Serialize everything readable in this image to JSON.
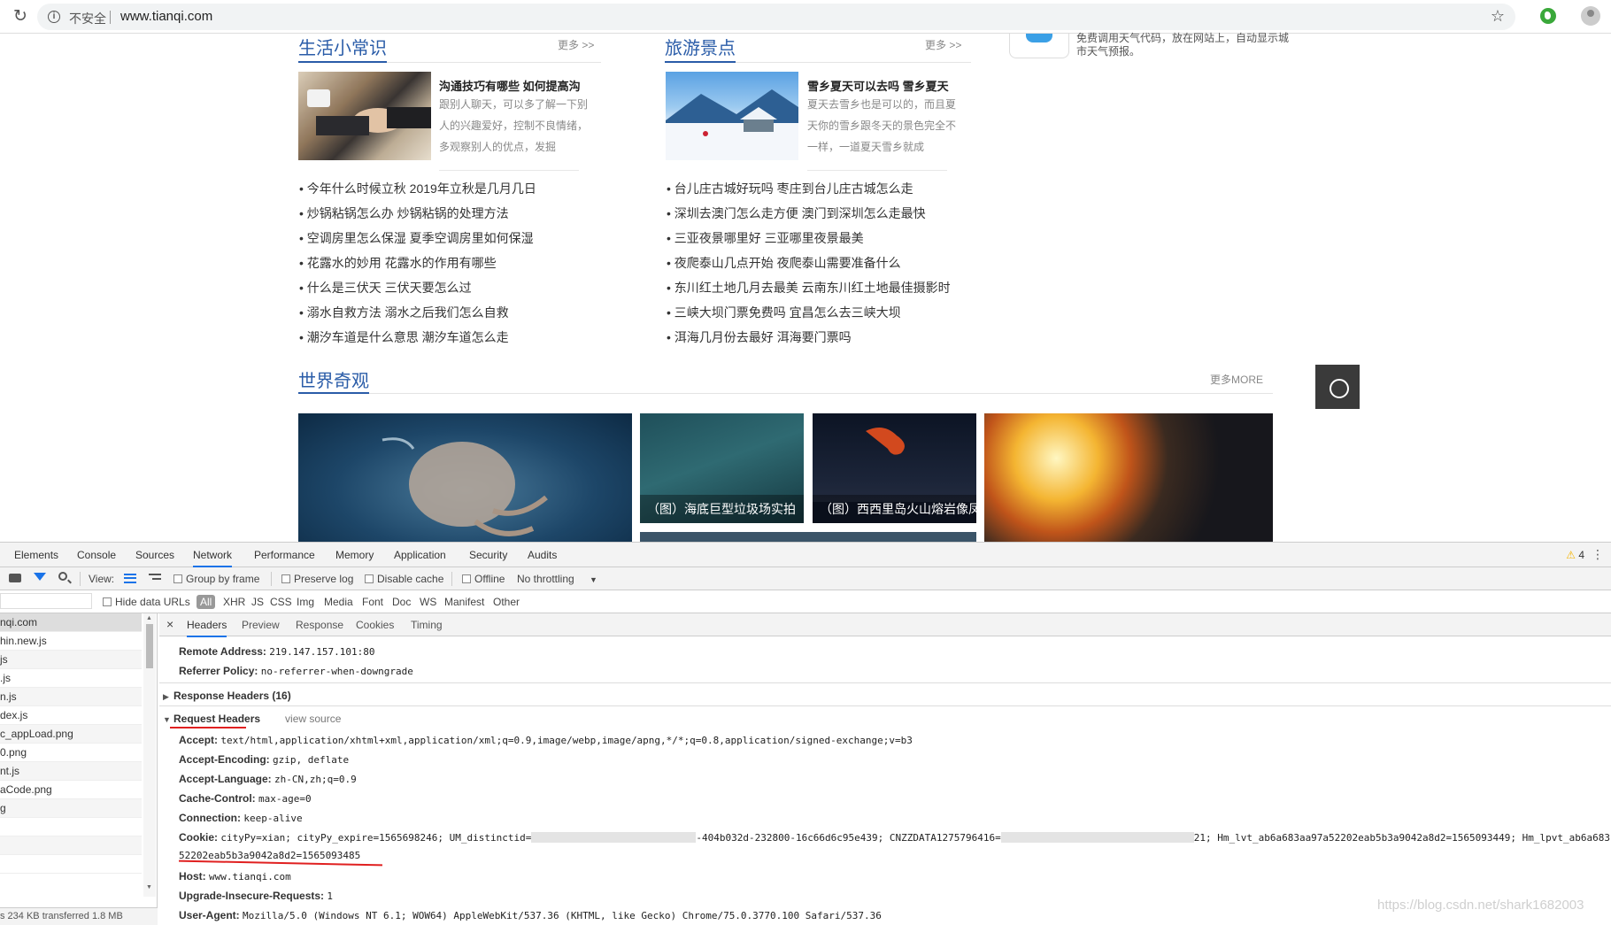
{
  "browser": {
    "insecure_label": "不安全",
    "url": "www.tianqi.com"
  },
  "life_tips": {
    "title": "生活小常识",
    "more": "更多 >>",
    "feature_title": "沟通技巧有哪些 如何提高沟",
    "feature_desc": "跟别人聊天，可以多了解一下别人的兴趣爱好，控制不良情绪，多观察别人的优点，发掘",
    "items": [
      "今年什么时候立秋 2019年立秋是几月几日",
      "炒锅粘锅怎么办 炒锅粘锅的处理方法",
      "空调房里怎么保湿 夏季空调房里如何保湿",
      "花露水的妙用 花露水的作用有哪些",
      "什么是三伏天 三伏天要怎么过",
      "溺水自救方法 溺水之后我们怎么自救",
      "潮汐车道是什么意思 潮汐车道怎么走"
    ]
  },
  "travel": {
    "title": "旅游景点",
    "more": "更多 >>",
    "feature_title": "雪乡夏天可以去吗 雪乡夏天",
    "feature_desc": "夏天去雪乡也是可以的，而且夏天你的雪乡跟冬天的景色完全不一样，一道夏天雪乡就成",
    "items": [
      "台儿庄古城好玩吗 枣庄到台儿庄古城怎么走",
      "深圳去澳门怎么走方便 澳门到深圳怎么走最快",
      "三亚夜景哪里好 三亚哪里夜景最美",
      "夜爬泰山几点开始 夜爬泰山需要准备什么",
      "东川红土地几月去最美 云南东川红土地最佳摄影时",
      "三峡大坝门票免费吗 宜昌怎么去三峡大坝",
      "洱海几月份去最好 洱海要门票吗"
    ]
  },
  "side": {
    "text": "免费调用天气代码，放在网站上，自动显示城市天气预报。"
  },
  "wonders": {
    "title": "世界奇观",
    "more": "更多MORE",
    "captions": [
      "（图）海底巨型垃圾场实拍",
      "（图）西西里岛火山熔岩像凤"
    ]
  },
  "devtools": {
    "tabs": [
      "Elements",
      "Console",
      "Sources",
      "Network",
      "Performance",
      "Memory",
      "Application",
      "Security",
      "Audits"
    ],
    "warnings": "4",
    "toolbar": {
      "view": "View:",
      "group_by_frame": "Group by frame",
      "preserve_log": "Preserve log",
      "disable_cache": "Disable cache",
      "offline": "Offline",
      "throttling": "No throttling"
    },
    "filter": {
      "hide_data_urls": "Hide data URLs",
      "all": "All",
      "types": [
        "XHR",
        "JS",
        "CSS",
        "Img",
        "Media",
        "Font",
        "Doc",
        "WS",
        "Manifest",
        "Other"
      ]
    },
    "requests": [
      "nqi.com",
      "hin.new.js",
      "js",
      ".js",
      "n.js",
      "dex.js",
      "c_appLoad.png",
      "0.png",
      "nt.js",
      "aCode.png",
      "g",
      "",
      "",
      ""
    ],
    "status": "s   234 KB transferred   1.8 MB",
    "detail_tabs": [
      "Headers",
      "Preview",
      "Response",
      "Cookies",
      "Timing"
    ],
    "remote_address": {
      "k": "Remote Address:",
      "v": "219.147.157.101:80"
    },
    "referrer_policy": {
      "k": "Referrer Policy:",
      "v": "no-referrer-when-downgrade"
    },
    "response_headers": "Response Headers (16)",
    "request_headers": "Request Headers",
    "view_source": "view source",
    "headers": {
      "accept": {
        "k": "Accept:",
        "v": "text/html,application/xhtml+xml,application/xml;q=0.9,image/webp,image/apng,*/*;q=0.8,application/signed-exchange;v=b3"
      },
      "accept_encoding": {
        "k": "Accept-Encoding:",
        "v": "gzip, deflate"
      },
      "accept_language": {
        "k": "Accept-Language:",
        "v": "zh-CN,zh;q=0.9"
      },
      "cache_control": {
        "k": "Cache-Control:",
        "v": "max-age=0"
      },
      "connection": {
        "k": "Connection:",
        "v": "keep-alive"
      },
      "cookie_k": "Cookie:",
      "cookie_a": "cityPy=xian; cityPy_expire=1565698246; UM_distinctid=",
      "cookie_b": "-404b032d-232800-16c66d6c95e439; CNZZDATA1275796416=",
      "cookie_c": "21; Hm_lvt_ab6a683aa97a52202eab5b3a9042a8d2=1565093449; Hm_lpvt_ab6a683",
      "cookie_d": "52202eab5b3a9042a8d2=1565093485",
      "host": {
        "k": "Host:",
        "v": "www.tianqi.com"
      },
      "upgrade": {
        "k": "Upgrade-Insecure-Requests:",
        "v": "1"
      },
      "user_agent": {
        "k": "User-Agent:",
        "v": "Mozilla/5.0 (Windows NT 6.1; WOW64) AppleWebKit/537.36 (KHTML, like Gecko) Chrome/75.0.3770.100 Safari/537.36"
      }
    }
  },
  "watermark": "https://blog.csdn.net/shark1682003"
}
